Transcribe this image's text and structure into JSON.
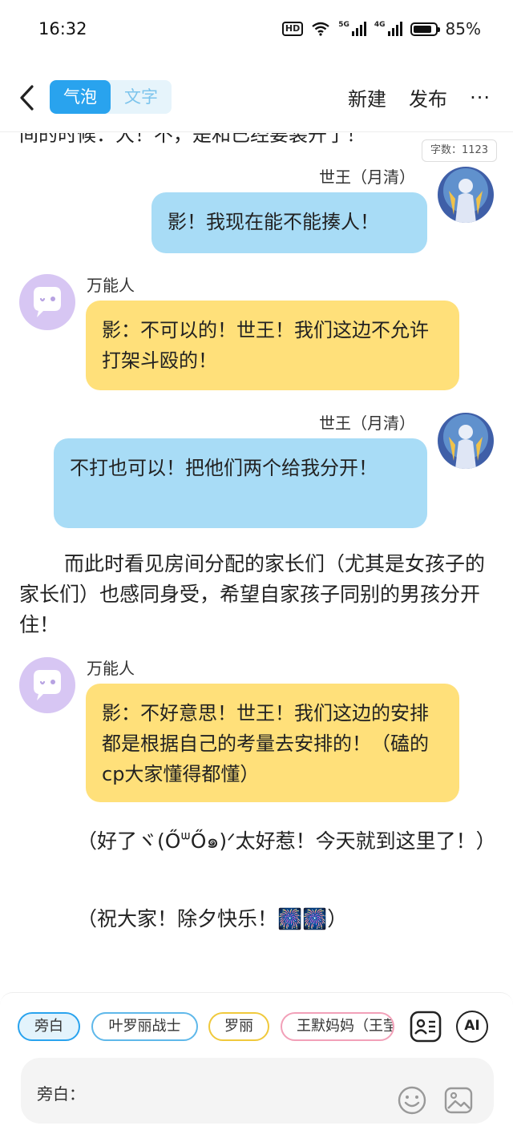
{
  "status_bar": {
    "time": "16:32",
    "hd": "HD",
    "signal1": "5G",
    "signal2": "4G",
    "battery_pct_text": "85%",
    "battery_level": 0.85
  },
  "header": {
    "tab_bubble": "气泡",
    "tab_text": "文字",
    "new_label": "新建",
    "publish_label": "发布",
    "more_label": "···"
  },
  "chat": {
    "cut_text": "间的时候：大！不，是和已经要装开了！",
    "word_count": "字数：1123",
    "messages": [
      {
        "speaker": "世王（月清）",
        "text": "影！我现在能不能揍人！"
      },
      {
        "speaker": "万能人",
        "text": "影：不可以的！世王！我们这边不允许打架斗殴的！"
      },
      {
        "speaker": "世王（月清）",
        "text": "不打也可以！把他们两个给我分开！"
      },
      {
        "narration": "而此时看见房间分配的家长们（尤其是女孩子的家长们）也感同身受，希望自家孩子同别的男孩分开住！"
      },
      {
        "speaker": "万能人",
        "text": "影：不好意思！世王！我们这边的安排都是根据自己的考量去安排的！（磕的cp大家懂得都懂）"
      },
      {
        "narration": "（好了ヾ(ŐᐜŐ๑)ᐟ太好惹！今天就到这里了！）"
      },
      {
        "narration": "（祝大家！除夕快乐！🎆🎆）"
      }
    ]
  },
  "bottom": {
    "chips": [
      "旁白",
      "叶罗丽战士",
      "罗丽",
      "王默妈妈（王莹）"
    ],
    "ai_label": "AI",
    "input_label": "旁白："
  },
  "colors": {
    "accent": "#29a3ee",
    "blue_bubble": "#a8dcf6",
    "yellow_bubble": "#ffe07a",
    "avatar_bg": "#d7c6f3"
  }
}
